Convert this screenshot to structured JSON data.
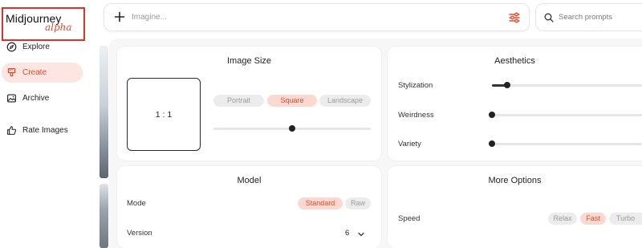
{
  "sidebar": {
    "logo": {
      "name": "Midjourney",
      "badge": "alpha"
    },
    "items": [
      {
        "label": "Explore",
        "icon": "compass-icon",
        "active": false
      },
      {
        "label": "Create",
        "icon": "brush-icon",
        "active": true
      },
      {
        "label": "Archive",
        "icon": "image-icon",
        "active": false
      },
      {
        "label": "Rate Images",
        "icon": "thumbs-up-icon",
        "active": false
      }
    ]
  },
  "topbar": {
    "imagine_placeholder": "Imagine...",
    "search_placeholder": "Search prompts"
  },
  "image_size": {
    "title": "Image Size",
    "ratio": "1 : 1",
    "options": [
      "Portrait",
      "Square",
      "Landscape"
    ],
    "selected": "Square",
    "slider_value": 0.5
  },
  "aesthetics": {
    "title": "Aesthetics",
    "sliders": [
      {
        "label": "Stylization",
        "value": 0.1
      },
      {
        "label": "Weirdness",
        "value": 0.0
      },
      {
        "label": "Variety",
        "value": 0.0
      }
    ]
  },
  "model": {
    "title": "Model",
    "mode_label": "Mode",
    "mode_options": [
      "Standard",
      "Raw"
    ],
    "mode_selected": "Standard",
    "version_label": "Version",
    "version_value": "6"
  },
  "more_options": {
    "title": "More Options",
    "speed_label": "Speed",
    "speed_options": [
      "Relax",
      "Fast",
      "Turbo"
    ],
    "speed_selected": "Fast"
  },
  "colors": {
    "accent": "#e54a2f",
    "accent_bg": "#fde6e1",
    "logo_border": "#e0302a"
  }
}
